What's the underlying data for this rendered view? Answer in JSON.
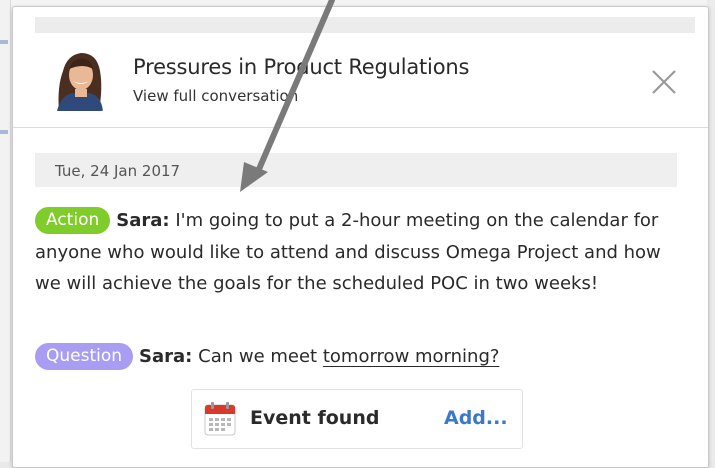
{
  "conversation": {
    "title": "Pressures in Product Regulations",
    "view_link": "View full conversation"
  },
  "close_icon": "close-icon",
  "date_header": "Tue, 24 Jan 2017",
  "messages": [
    {
      "tag": "Action",
      "speaker": "Sara:",
      "text": "I'm going to put a 2-hour meeting on the calendar for anyone who would like to attend and discuss Omega Project and how we will achieve the goals for the scheduled POC in two weeks!"
    },
    {
      "tag": "Question",
      "speaker": "Sara:",
      "text_before": "Can we meet ",
      "highlighted": "tomorrow morning?"
    }
  ],
  "event_suggestion": {
    "icon": "calendar-icon",
    "label": "Event found",
    "action": "Add..."
  },
  "colors": {
    "action_tag": "#7fcc2b",
    "question_tag": "#a99cf3",
    "link": "#3a78c9",
    "annotation_arrow": "#7a7a7a"
  }
}
